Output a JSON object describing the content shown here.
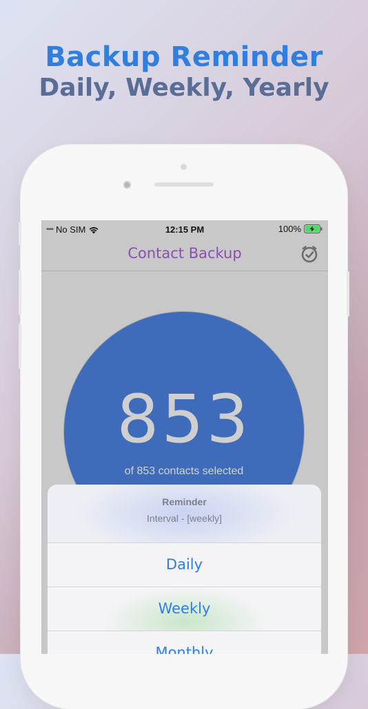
{
  "promo": {
    "title": "Backup Reminder",
    "subtitle": "Daily, Weekly, Yearly"
  },
  "status_bar": {
    "signal": "••••",
    "carrier": "No SIM",
    "time": "12:15 PM",
    "battery": "100%"
  },
  "nav": {
    "title": "Contact Backup",
    "reminder_icon": "alarm-clock-icon"
  },
  "summary": {
    "count": "853",
    "caption": "of 853 contacts selected"
  },
  "action_sheet": {
    "title": "Reminder",
    "message": "Interval - [weekly]",
    "options": [
      "Daily",
      "Weekly",
      "Monthly"
    ]
  },
  "colors": {
    "accent": "#2f7fe0",
    "nav_title": "#8a4fb0",
    "circle": "#3f6bbb",
    "battery_fill": "#4cd964"
  }
}
